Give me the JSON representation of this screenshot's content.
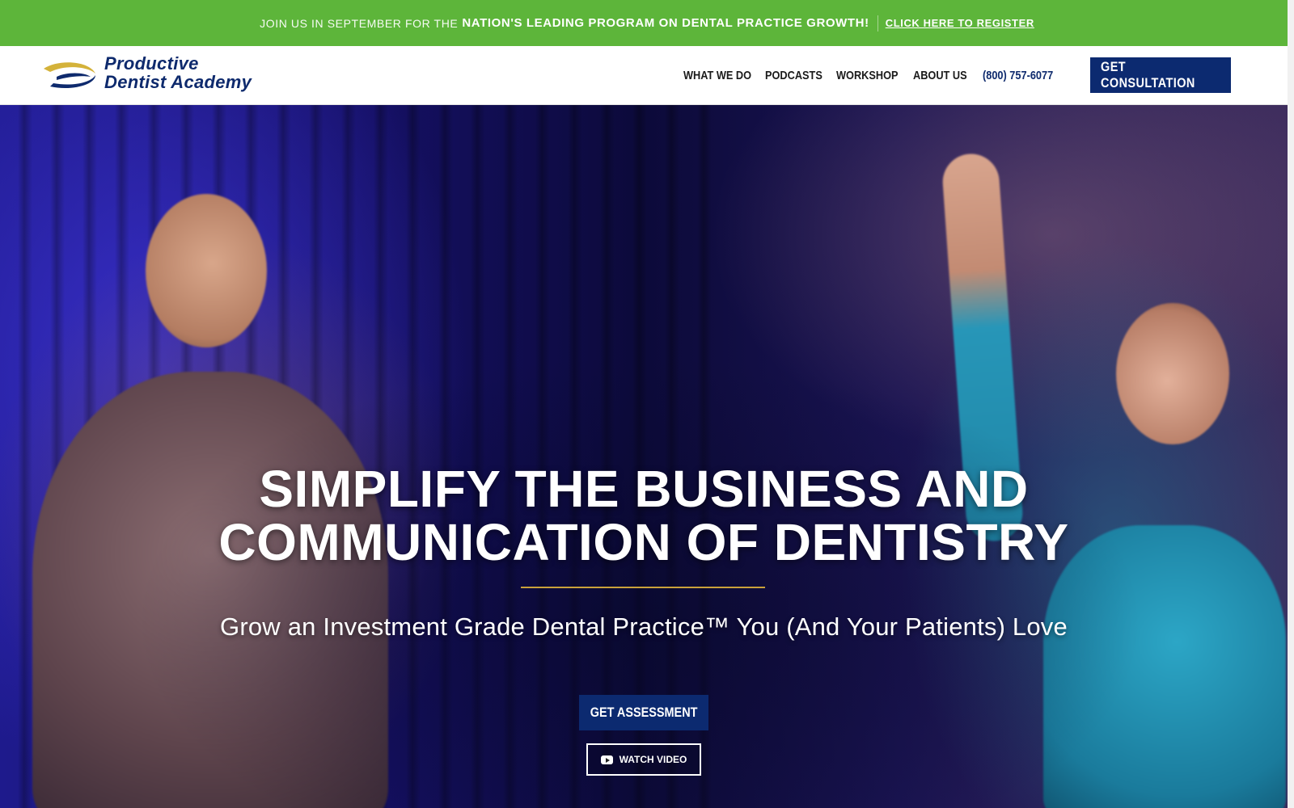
{
  "announcement": {
    "lead": "Join us in September for the",
    "highlight": "Nation's leading program on dental practice growth!",
    "link": "Click here to register"
  },
  "brand": {
    "name_line1": "Productive",
    "name_line2": "Dentist Academy",
    "colors": {
      "navy": "#0c2a70",
      "gold": "#c9a13b",
      "green": "#5db53a"
    }
  },
  "nav": {
    "items": [
      "What we do",
      "Podcasts",
      "Workshop",
      "About Us"
    ],
    "phone": "(800) 757-6077",
    "cta": "Get Consultation"
  },
  "hero": {
    "headline_line1": "Simplify the business and",
    "headline_line2": "communication of dentistry",
    "subheadline": "Grow an Investment Grade Dental Practice™ You (And Your Patients) Love",
    "primary_button": "Get Assessment",
    "secondary_button": "Watch Video",
    "secondary_icon": "youtube-play-icon"
  }
}
